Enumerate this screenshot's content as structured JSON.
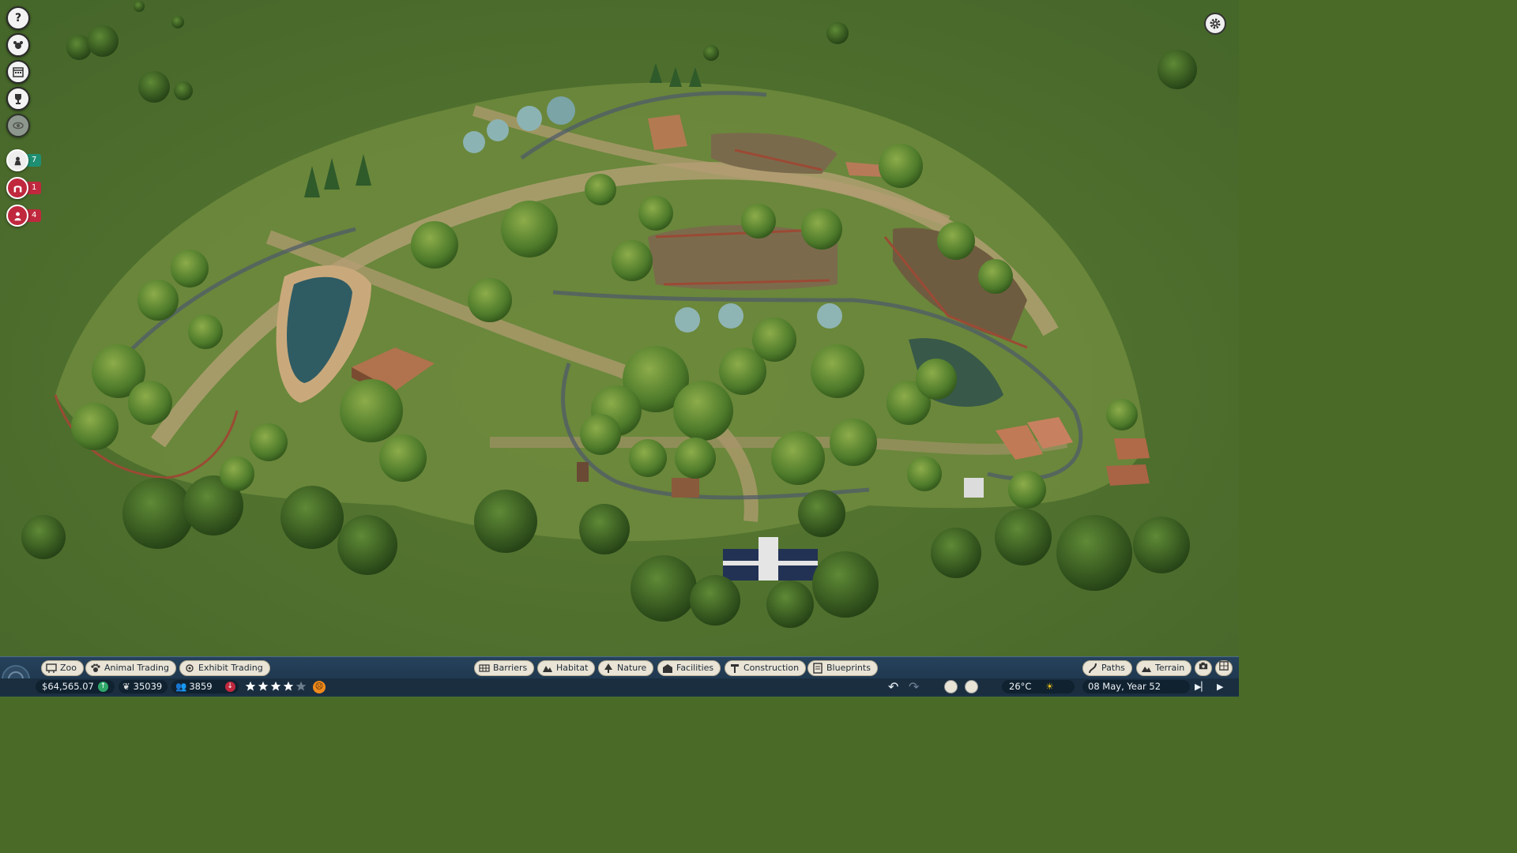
{
  "bottom_bar": {
    "left_tabs": [
      {
        "label": "Zoo",
        "icon": "zoo-sign-icon"
      },
      {
        "label": "Animal Trading",
        "icon": "paw-icon"
      },
      {
        "label": "Exhibit Trading",
        "icon": "exhibit-icon"
      }
    ],
    "center_tabs": [
      {
        "label": "Barriers",
        "icon": "fence-icon"
      },
      {
        "label": "Habitat",
        "icon": "habitat-icon"
      },
      {
        "label": "Nature",
        "icon": "tree-icon"
      },
      {
        "label": "Facilities",
        "icon": "building-icon"
      },
      {
        "label": "Construction",
        "icon": "construction-icon"
      },
      {
        "label": "Blueprints",
        "icon": "blueprint-icon"
      }
    ],
    "right_tabs": [
      {
        "label": "Paths",
        "icon": "path-icon"
      },
      {
        "label": "Terrain",
        "icon": "terrain-icon"
      }
    ],
    "stats": {
      "money": "$64,565.07",
      "conservation_credits": "35039",
      "guests": "3859",
      "rating_stars": 4,
      "rating_max": 5,
      "temperature": "26°C",
      "date": "08 May, Year 52"
    }
  },
  "left_hud": {
    "buttons": [
      {
        "icon": "help-icon"
      },
      {
        "icon": "animal-icon"
      },
      {
        "icon": "calendar-icon"
      },
      {
        "icon": "trophy-icon"
      },
      {
        "icon": "eye-icon"
      }
    ],
    "alerts": [
      {
        "icon": "staff-icon",
        "count": "7",
        "color": "#1e8f72"
      },
      {
        "icon": "gate-icon",
        "count": "1",
        "color": "#c0283e"
      },
      {
        "icon": "guest-icon",
        "count": "4",
        "color": "#c0283e"
      }
    ]
  },
  "colors": {
    "grass": "#4a6b28",
    "bar_bg": "#1f3850",
    "pill_bg": "#e9e4d6",
    "alert_green": "#1e8f72",
    "alert_red": "#c0283e",
    "money_up": "#2fa86a",
    "guest_down": "#c0283e",
    "mood_face": "#f08a1c"
  }
}
